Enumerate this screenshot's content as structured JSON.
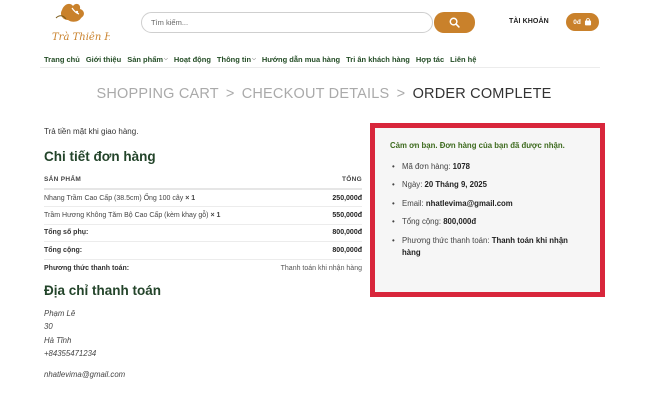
{
  "header": {
    "logo_text": "Trà Thiên Hương",
    "search_placeholder": "Tìm kiếm...",
    "account_label": "TÀI KHOẢN",
    "cart_amount": "0đ"
  },
  "nav": {
    "items": [
      {
        "label": "Trang chủ",
        "dropdown": false
      },
      {
        "label": "Giới thiệu",
        "dropdown": false
      },
      {
        "label": "Sản phẩm",
        "dropdown": true
      },
      {
        "label": "Hoạt động",
        "dropdown": false
      },
      {
        "label": "Thông tin",
        "dropdown": true
      },
      {
        "label": "Hướng dẫn mua hàng",
        "dropdown": false
      },
      {
        "label": "Tri ân khách hàng",
        "dropdown": false
      },
      {
        "label": "Hợp tác",
        "dropdown": false
      },
      {
        "label": "Liên hệ",
        "dropdown": false
      }
    ]
  },
  "steps": {
    "cart": "SHOPPING CART",
    "sep": ">",
    "checkout": "CHECKOUT DETAILS",
    "complete": "ORDER COMPLETE"
  },
  "order": {
    "payment_note": "Trả tiền mặt khi giao hàng.",
    "heading": "Chi tiết đơn hàng",
    "col_product": "SẢN PHẨM",
    "col_total": "TỔNG",
    "items": [
      {
        "name": "Nhang Trầm Cao Cấp (38.5cm) Ống 100 cây",
        "qty": "× 1",
        "total": "250,000đ"
      },
      {
        "name": "Trầm Hương Không Tăm Bộ Cao Cấp (kèm khay gỗ)",
        "qty": "× 1",
        "total": "550,000đ"
      }
    ],
    "subtotal_label": "Tổng số phụ:",
    "subtotal_value": "800,000đ",
    "total_label": "Tổng cộng:",
    "total_value": "800,000đ",
    "method_label": "Phương thức thanh toán:",
    "method_value": "Thanh toán khi nhận hàng"
  },
  "billing": {
    "heading": "Địa chỉ thanh toán",
    "lines": [
      "Phạm Lê",
      "30",
      "Hà Tĩnh",
      "+84355471234"
    ],
    "email": "nhatlevima@gmail.com"
  },
  "thanks": {
    "message": "Cảm ơn bạn. Đơn hàng của bạn đã được nhận.",
    "order_no_label": "Mã đơn hàng:",
    "order_no": "1078",
    "date_label": "Ngày:",
    "date": "20 Tháng 9, 2025",
    "email_label": "Email:",
    "email": "nhatlevima@gmail.com",
    "total_label": "Tổng cộng:",
    "total": "800,000đ",
    "method_label": "Phương thức thanh toán:",
    "method": "Thanh toán khi nhận hàng"
  },
  "colors": {
    "accent": "#c9812b",
    "green": "#23442a",
    "highlight_border": "#d8263b"
  }
}
